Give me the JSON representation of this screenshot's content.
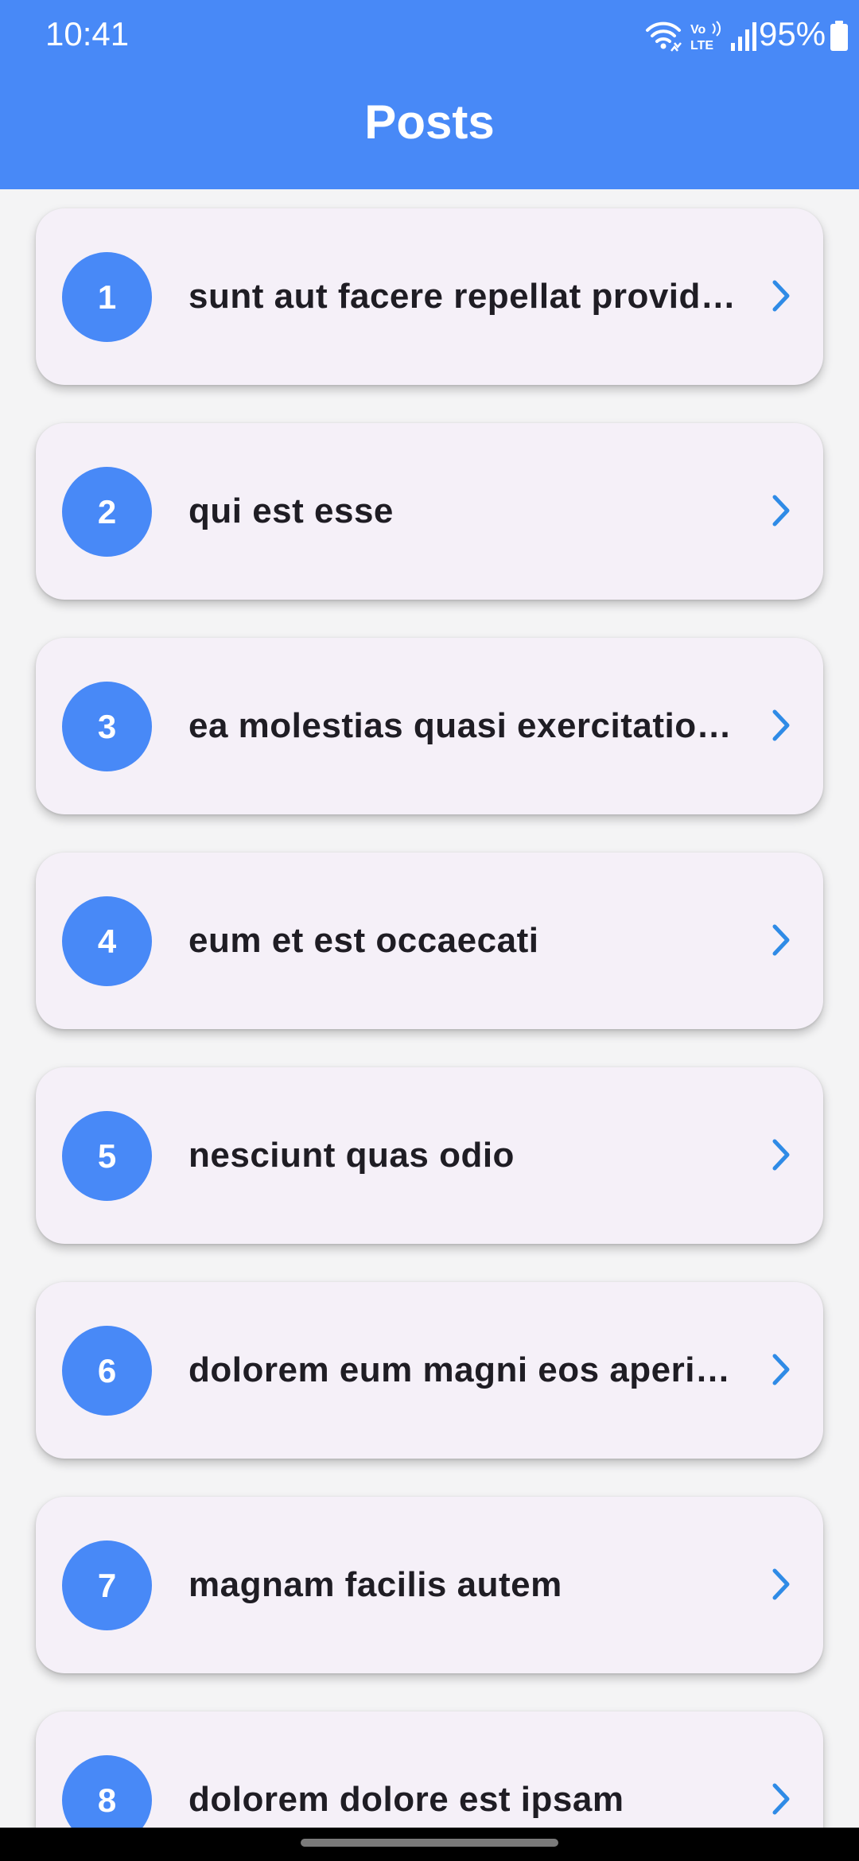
{
  "status_bar": {
    "time": "10:41",
    "battery": "95%",
    "icons": [
      "wifi-icon",
      "volte-icon",
      "signal-icon",
      "battery-icon"
    ]
  },
  "app_bar": {
    "title": "Posts",
    "color": "#4889f7"
  },
  "posts": [
    {
      "id": "1",
      "title": "sunt aut facere repellat provident occaecati excepturi optio reprehenderit"
    },
    {
      "id": "2",
      "title": "qui est esse"
    },
    {
      "id": "3",
      "title": "ea molestias quasi exercitationem repellat qui ipsa sit aut"
    },
    {
      "id": "4",
      "title": "eum et est occaecati"
    },
    {
      "id": "5",
      "title": "nesciunt quas odio"
    },
    {
      "id": "6",
      "title": "dolorem eum magni eos aperiam quia"
    },
    {
      "id": "7",
      "title": "magnam facilis autem"
    },
    {
      "id": "8",
      "title": "dolorem dolore est ipsam"
    }
  ],
  "colors": {
    "accent": "#4889f7",
    "chevron": "#2f8be6",
    "card": "#f5f0f8",
    "background": "#f4f4f5",
    "text": "#1f1d24"
  },
  "item_icons": {
    "trailing": "chevron-right-icon"
  }
}
